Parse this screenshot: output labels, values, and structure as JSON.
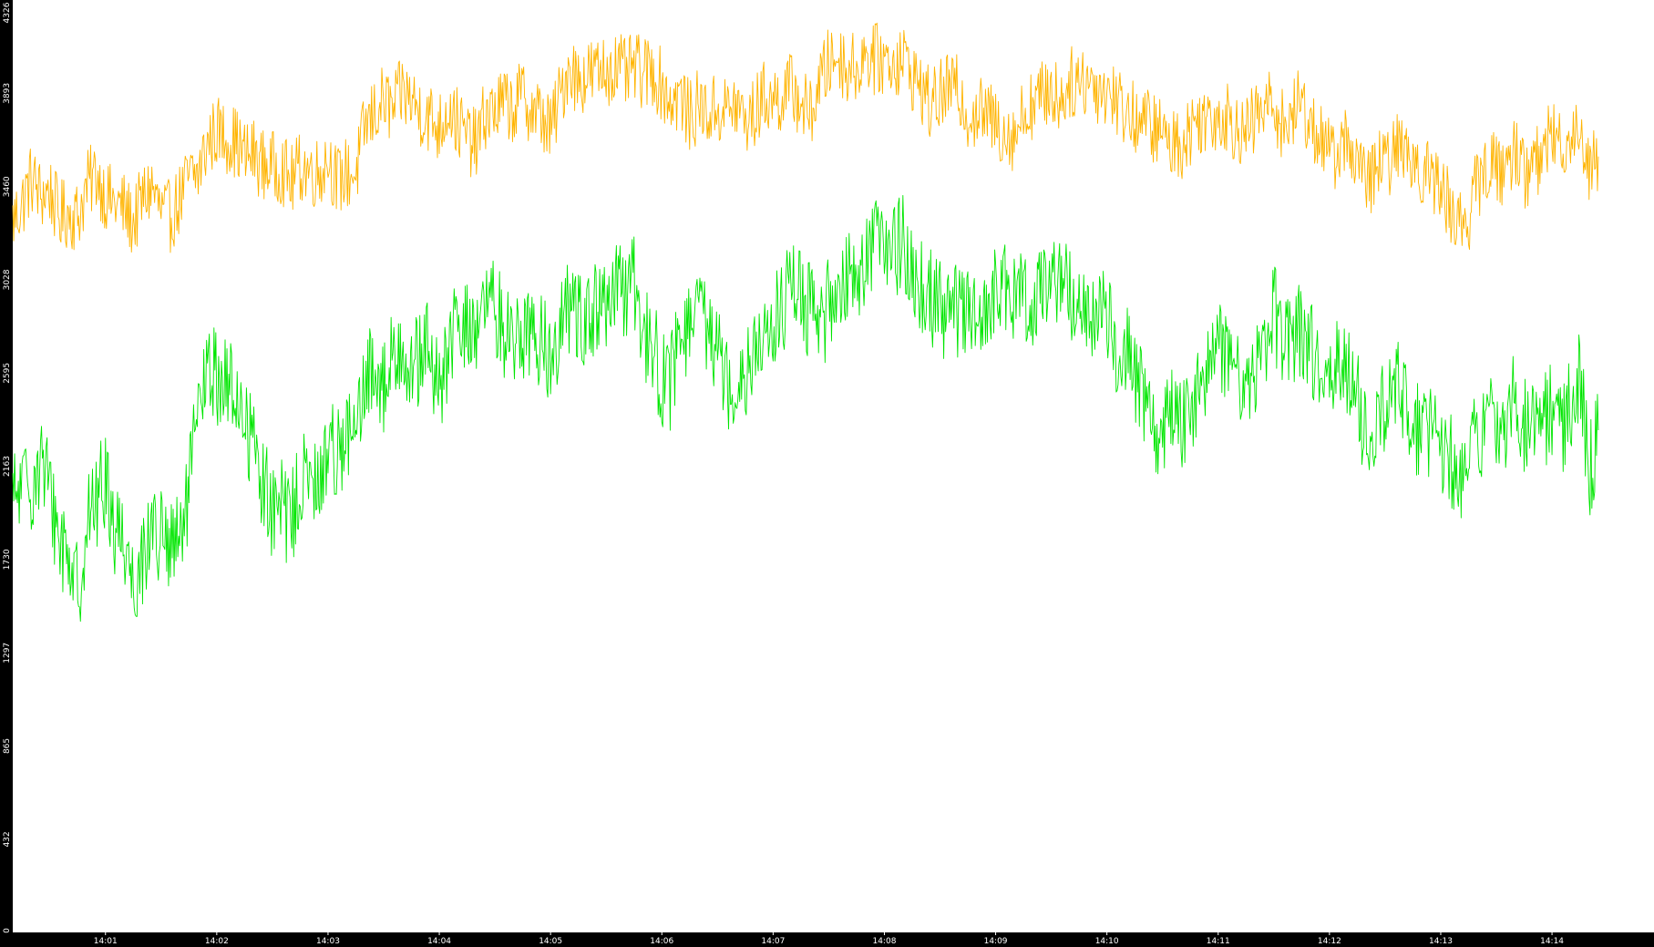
{
  "colors": {
    "background": "#000000",
    "plot_background": "#ffffff",
    "axis_text": "#ffffff",
    "series_yellow": "#ffb400",
    "series_green": "#00e600"
  },
  "chart_data": {
    "type": "line",
    "title": "",
    "xlabel": "",
    "ylabel": "",
    "grid": false,
    "legend": "none",
    "x_range": [
      "14:00:10",
      "14:14:55"
    ],
    "x_ticks": [
      "14:01",
      "14:02",
      "14:03",
      "14:04",
      "14:05",
      "14:06",
      "14:07",
      "14:08",
      "14:09",
      "14:10",
      "14:11",
      "14:12",
      "14:13",
      "14:14"
    ],
    "ylim": [
      0,
      4326
    ],
    "y_ticks": [
      0,
      432,
      865,
      1297,
      1730,
      2163,
      2595,
      3028,
      3460,
      3893,
      4326
    ],
    "sample_interval_seconds": 5,
    "series": [
      {
        "color": "#ffb400",
        "values": [
          3300,
          3380,
          3500,
          3420,
          3440,
          3320,
          3340,
          3320,
          3460,
          3520,
          3420,
          3380,
          3360,
          3290,
          3400,
          3460,
          3340,
          3320,
          3400,
          3500,
          3520,
          3660,
          3720,
          3690,
          3670,
          3600,
          3610,
          3560,
          3550,
          3550,
          3480,
          3550,
          3540,
          3520,
          3600,
          3480,
          3520,
          3520,
          3740,
          3800,
          3860,
          3810,
          3900,
          3860,
          3810,
          3780,
          3730,
          3840,
          3750,
          3690,
          3650,
          3800,
          3810,
          3850,
          3820,
          3890,
          3810,
          3790,
          3720,
          3870,
          4030,
          3950,
          3980,
          3990,
          4000,
          4020,
          3980,
          4010,
          3980,
          4000,
          3930,
          3860,
          3880,
          3780,
          3840,
          3800,
          3820,
          3810,
          3840,
          3760,
          3800,
          3880,
          3860,
          3880,
          3920,
          3850,
          3790,
          3940,
          4030,
          4070,
          4010,
          4010,
          4080,
          4050,
          4050,
          4040,
          4060,
          3980,
          3920,
          3830,
          3880,
          3920,
          3900,
          3800,
          3800,
          3800,
          3750,
          3720,
          3700,
          3800,
          3850,
          3880,
          3910,
          3860,
          3940,
          3950,
          3960,
          3920,
          3910,
          3870,
          3810,
          3780,
          3760,
          3740,
          3700,
          3660,
          3660,
          3720,
          3780,
          3780,
          3800,
          3780,
          3740,
          3700,
          3780,
          3820,
          3850,
          3740,
          3790,
          3860,
          3740,
          3700,
          3600,
          3630,
          3680,
          3580,
          3460,
          3550,
          3560,
          3620,
          3640,
          3590,
          3540,
          3500,
          3460,
          3370,
          3290,
          3320,
          3480,
          3550,
          3550,
          3540,
          3640,
          3520,
          3560,
          3620,
          3700,
          3660,
          3690,
          3740,
          3560,
          3600
        ]
      },
      {
        "color": "#00e600",
        "values": [
          2000,
          2060,
          2080,
          2200,
          2040,
          1830,
          1770,
          1570,
          1900,
          2000,
          2100,
          1880,
          1840,
          1620,
          1730,
          1900,
          1820,
          1770,
          1800,
          2050,
          2400,
          2600,
          2580,
          2540,
          2500,
          2370,
          2270,
          2080,
          1950,
          1970,
          1900,
          2100,
          2080,
          2050,
          2260,
          2250,
          2300,
          2300,
          2500,
          2660,
          2520,
          2660,
          2760,
          2600,
          2660,
          2720,
          2460,
          2720,
          2790,
          2800,
          2820,
          2880,
          2900,
          2800,
          2760,
          2780,
          2800,
          2730,
          2680,
          2800,
          2900,
          2880,
          2840,
          2880,
          2890,
          2960,
          2970,
          3000,
          2780,
          2750,
          2550,
          2560,
          2750,
          2820,
          2840,
          2800,
          2740,
          2560,
          2580,
          2620,
          2720,
          2720,
          2800,
          2910,
          2960,
          2980,
          2870,
          2810,
          2900,
          3000,
          3070,
          3060,
          3120,
          3220,
          3220,
          3160,
          3200,
          3060,
          2990,
          2950,
          2900,
          2880,
          2900,
          2840,
          2870,
          2900,
          2980,
          2960,
          2900,
          2970,
          2940,
          3020,
          3020,
          3020,
          2980,
          2920,
          2860,
          2880,
          2820,
          2720,
          2740,
          2580,
          2500,
          2360,
          2340,
          2420,
          2360,
          2450,
          2460,
          2720,
          2720,
          2700,
          2620,
          2560,
          2640,
          2760,
          2880,
          2720,
          2720,
          2810,
          2700,
          2640,
          2640,
          2640,
          2620,
          2560,
          2220,
          2420,
          2410,
          2560,
          2500,
          2380,
          2300,
          2320,
          2190,
          2200,
          2130,
          2220,
          2320,
          2360,
          2360,
          2350,
          2540,
          2350,
          2390,
          2380,
          2420,
          2300,
          2470,
          2590,
          2120,
          2330
        ]
      }
    ]
  }
}
